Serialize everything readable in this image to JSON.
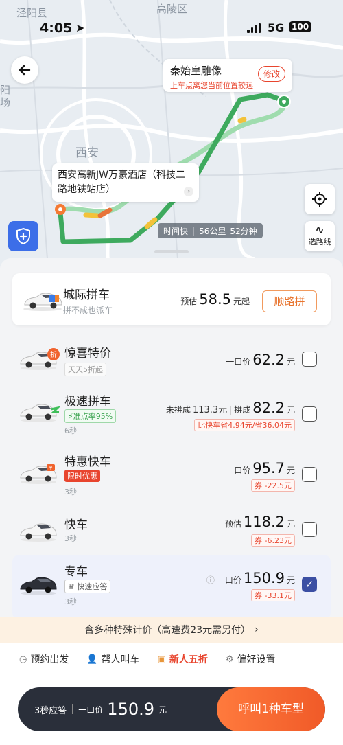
{
  "status": {
    "time": "4:05",
    "network": "5G",
    "battery": "100"
  },
  "map": {
    "labels": [
      "泾阳县",
      "高陵区",
      "西安",
      "阳",
      "场"
    ],
    "destination": {
      "name": "秦始皇雕像",
      "warning": "上车点离您当前位置较远",
      "modify": "修改"
    },
    "origin": {
      "name": "西安高新JW万豪酒店（科技二路地铁站店）"
    },
    "route": {
      "tag": "时间快",
      "distance": "56公里",
      "duration": "52分钟"
    },
    "routes_button": "选路线"
  },
  "options": [
    {
      "name": "城际拼车",
      "sub": "拼不成也派车",
      "price_label": "预估",
      "price": "58.5",
      "price_unit": "元起",
      "action": "顺路拼"
    },
    {
      "name": "惊喜特价",
      "tag": "天天5折起",
      "price_label": "一口价",
      "price": "62.2",
      "price_unit": "元",
      "checked": false
    },
    {
      "name": "极速拼车",
      "tag": "⚡准点率95%",
      "wait": "6秒",
      "price_label": "未拼成",
      "price_alt": "113.3元",
      "price_label2": "拼成",
      "price": "82.2",
      "price_unit": "元",
      "coupon": "比快车省4.94元/省36.04元",
      "checked": false
    },
    {
      "name": "特惠快车",
      "tag": "限时优惠",
      "wait": "3秒",
      "price_label": "一口价",
      "price": "95.7",
      "price_unit": "元",
      "coupon": "券 -22.5元",
      "checked": false
    },
    {
      "name": "快车",
      "wait": "3秒",
      "price_label": "预估",
      "price": "118.2",
      "price_unit": "元",
      "coupon": "券 -6.23元",
      "checked": false
    },
    {
      "name": "专车",
      "tag": "快速应答",
      "wait": "3秒",
      "price_label": "一口价",
      "price": "150.9",
      "price_unit": "元",
      "coupon": "券 -33.1元",
      "checked": true
    }
  ],
  "special_notice": "含多种特殊计价（高速费23元需另付）",
  "bottom_options": [
    {
      "label": "预约出发",
      "icon": "clock-icon"
    },
    {
      "label": "帮人叫车",
      "icon": "person-icon"
    },
    {
      "label": "新人五折",
      "icon": "gift-icon",
      "highlight": true
    },
    {
      "label": "偏好设置",
      "icon": "settings-icon"
    }
  ],
  "call_bar": {
    "wait": "3秒应答",
    "price_label": "一口价",
    "price": "150.9",
    "price_unit": "元",
    "button": "呼叫1种车型"
  },
  "colors": {
    "accent": "#f05a28",
    "route_green": "#3eaa5e",
    "selected": "#3b4fa3",
    "coupon_red": "#e8452e"
  }
}
